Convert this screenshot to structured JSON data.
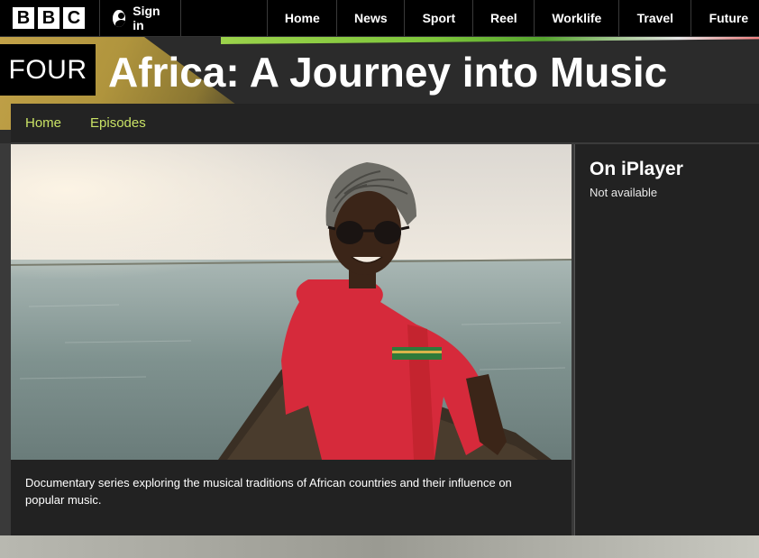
{
  "top_bar": {
    "logo": [
      "B",
      "B",
      "C"
    ],
    "sign_in_label": "Sign in",
    "nav": [
      "Home",
      "News",
      "Sport",
      "Reel",
      "Worklife",
      "Travel",
      "Future"
    ]
  },
  "programme": {
    "channel": "FOUR",
    "title": "Africa: A Journey into Music",
    "subnav": [
      "Home",
      "Episodes"
    ]
  },
  "hero": {
    "caption": "Documentary series exploring the musical traditions of African countries and their influence on popular music."
  },
  "iplayer": {
    "heading": "On iPlayer",
    "status": "Not available"
  },
  "colors": {
    "accent_green": "#c9e265",
    "gold": "#caa84a",
    "background": "#2b2b2b"
  }
}
